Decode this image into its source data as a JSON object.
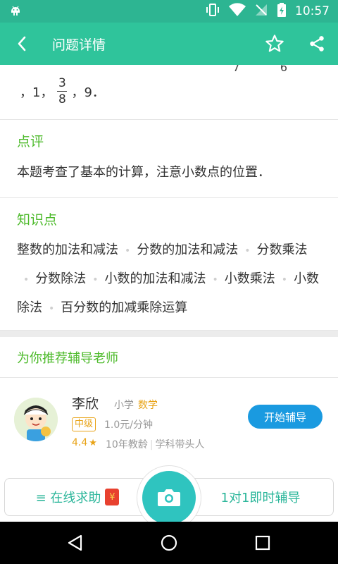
{
  "status_bar": {
    "time": "10:57"
  },
  "app_bar": {
    "title": "问题详情"
  },
  "question_tail": {
    "cut_fraction": "7 6",
    "seq": {
      "p1": "，1，",
      "num": "3",
      "den": "8",
      "p2": "，9．"
    }
  },
  "comment": {
    "title": "点评",
    "text": "本题考查了基本的计算，注意小数点的位置．"
  },
  "knowledge": {
    "title": "知识点",
    "items": [
      "整数的加法和减法",
      "分数的加法和减法",
      "分数乘法",
      "分数除法",
      "小数的加法和减法",
      "小数乘法",
      "小数除法",
      "百分数的加减乘除运算"
    ]
  },
  "recommend": {
    "title": "为你推荐辅导老师"
  },
  "teacher": {
    "name": "李欣",
    "grade": "小学",
    "subject": "数学",
    "level": "中级",
    "price": "1.0元/分钟",
    "rating": "4.4",
    "star": "★",
    "years": "10年教龄",
    "tag": "学科带头人",
    "button": "开始辅导"
  },
  "bottom": {
    "left_label": "≡ 在线求助",
    "redpacket": "¥",
    "right_label": "1对1即时辅导"
  },
  "colors": {
    "accent": "#2fc49b",
    "green_title": "#4cba2a",
    "button_blue": "#1a9ae0",
    "gold": "#e8a317"
  }
}
